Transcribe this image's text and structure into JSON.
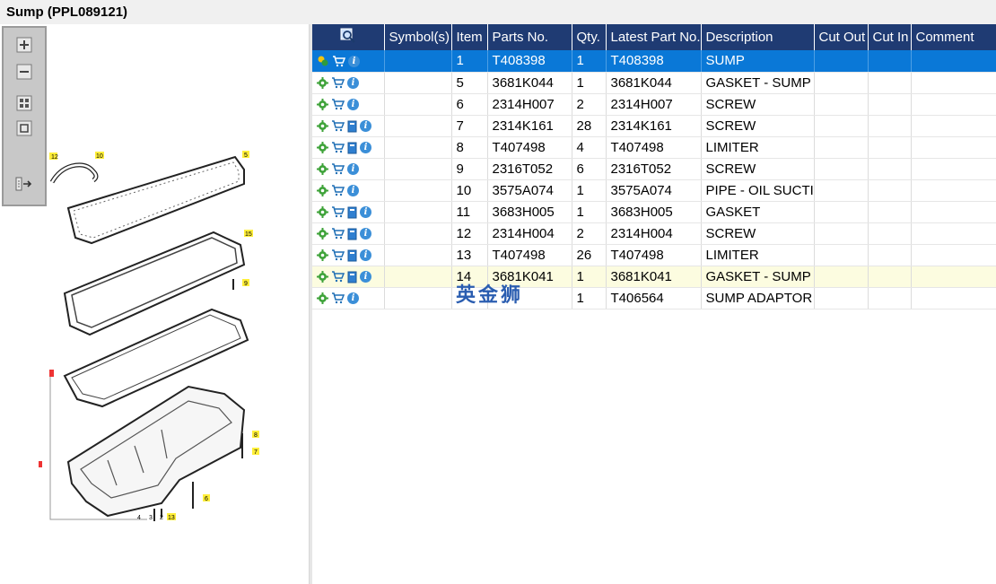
{
  "window": {
    "title": "Sump (PPL089121)"
  },
  "toolbar": {
    "zoom_in": "zoom-in",
    "zoom_out": "zoom-out",
    "fit_all": "fit-all",
    "fit_window": "fit-window",
    "export": "export"
  },
  "diagram": {
    "callouts": [
      "12",
      "10",
      "5",
      "15",
      "9",
      "8",
      "7",
      "6",
      "4",
      "3",
      "2",
      "13"
    ]
  },
  "table": {
    "headers": {
      "symbols": "Symbol(s)",
      "item": "Item",
      "parts_no": "Parts No.",
      "qty": "Qty.",
      "latest": "Latest Part No.",
      "description": "Description",
      "cut_out": "Cut Out",
      "cut_in": "Cut In",
      "comment": "Comment"
    },
    "rows": [
      {
        "item": "1",
        "parts_no": "T408398",
        "qty": "1",
        "latest": "T408398",
        "description": "SUMP"
      },
      {
        "item": "5",
        "parts_no": "3681K044",
        "qty": "1",
        "latest": "3681K044",
        "description": "GASKET - SUMP"
      },
      {
        "item": "6",
        "parts_no": "2314H007",
        "qty": "2",
        "latest": "2314H007",
        "description": "SCREW"
      },
      {
        "item": "7",
        "parts_no": "2314K161",
        "qty": "28",
        "latest": "2314K161",
        "description": "SCREW"
      },
      {
        "item": "8",
        "parts_no": "T407498",
        "qty": "4",
        "latest": "T407498",
        "description": "LIMITER"
      },
      {
        "item": "9",
        "parts_no": "2316T052",
        "qty": "6",
        "latest": "2316T052",
        "description": "SCREW"
      },
      {
        "item": "10",
        "parts_no": "3575A074",
        "qty": "1",
        "latest": "3575A074",
        "description": "PIPE - OIL SUCTION"
      },
      {
        "item": "11",
        "parts_no": "3683H005",
        "qty": "1",
        "latest": "3683H005",
        "description": "GASKET"
      },
      {
        "item": "12",
        "parts_no": "2314H004",
        "qty": "2",
        "latest": "2314H004",
        "description": "SCREW"
      },
      {
        "item": "13",
        "parts_no": "T407498",
        "qty": "26",
        "latest": "T407498",
        "description": "LIMITER"
      },
      {
        "item": "14",
        "parts_no": "3681K041",
        "qty": "1",
        "latest": "3681K041",
        "description": "GASKET - SUMP"
      },
      {
        "item": "",
        "parts_no": "",
        "qty": "1",
        "latest": "T406564",
        "description": "SUMP ADAPTOR"
      }
    ],
    "selected_index": 0,
    "hover_index": 10
  },
  "watermark": "英金狮"
}
